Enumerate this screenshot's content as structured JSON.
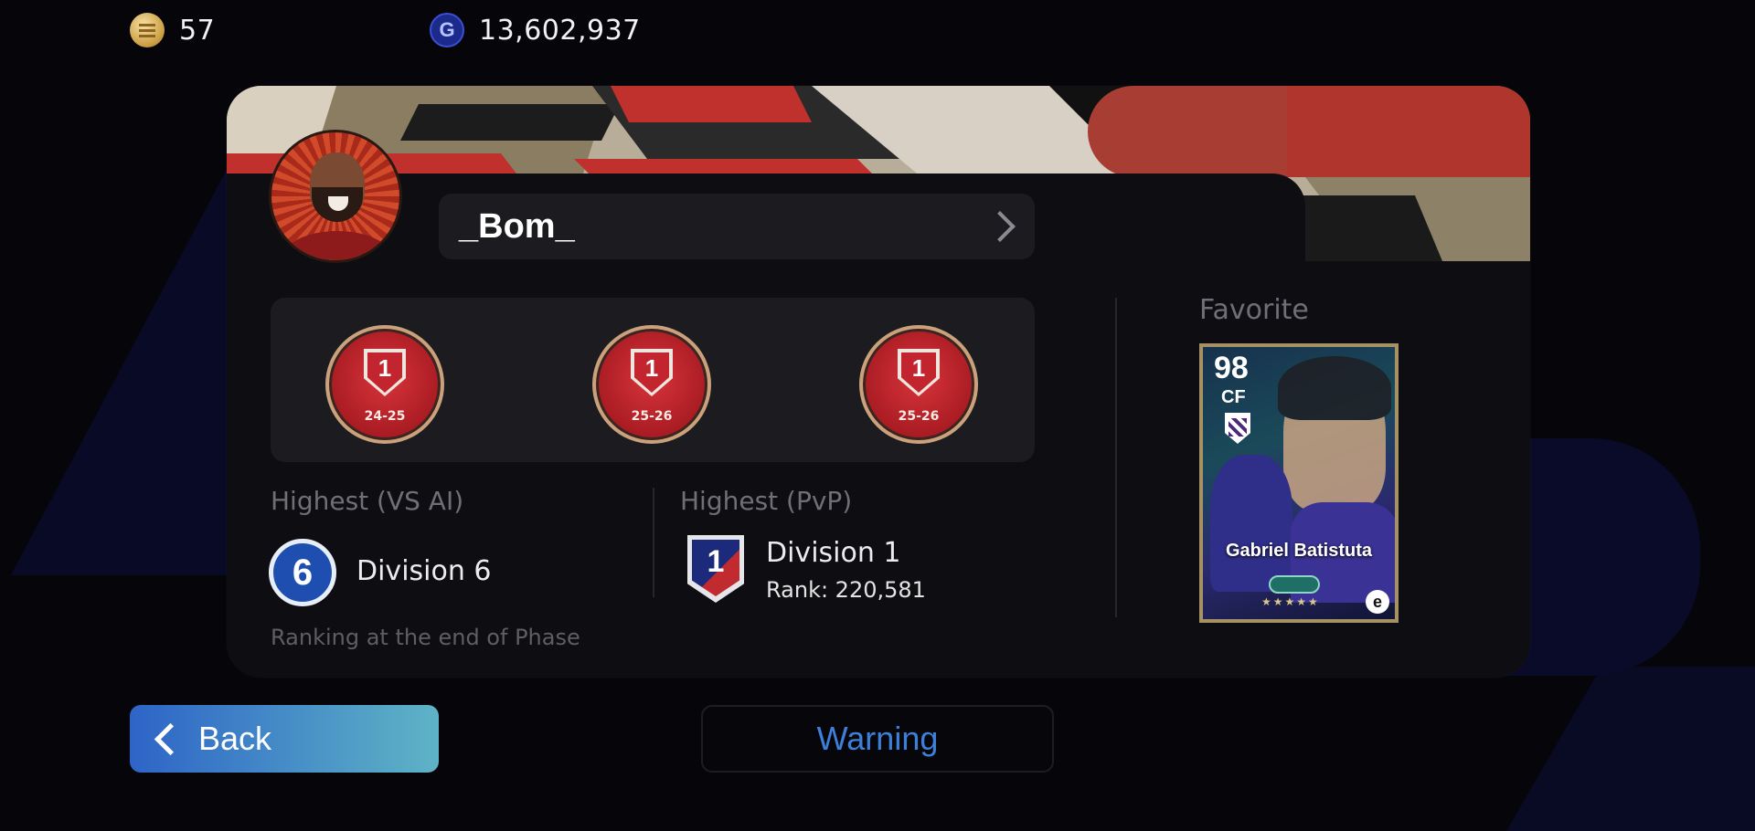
{
  "currency": {
    "coins": "57",
    "gp": "13,602,937",
    "gp_icon_letter": "G"
  },
  "profile": {
    "username": "_Bom_"
  },
  "badges": [
    {
      "rank": "1",
      "season": "24-25"
    },
    {
      "rank": "1",
      "season": "25-26"
    },
    {
      "rank": "1",
      "season": "25-26"
    }
  ],
  "highest_vs_ai": {
    "label": "Highest (VS AI)",
    "icon_number": "6",
    "division": "Division 6",
    "note": "Ranking at the end of Phase"
  },
  "highest_pvp": {
    "label": "Highest (PvP)",
    "icon_number": "1",
    "division": "Division 1",
    "rank": "Rank: 220,581"
  },
  "favorite": {
    "label": "Favorite",
    "rating": "98",
    "position": "CF",
    "player_name": "Gabriel Batistuta",
    "stars": "★★★★★",
    "logo_letter": "e"
  },
  "buttons": {
    "back": "Back",
    "warning": "Warning"
  },
  "colors": {
    "background": "#05050a",
    "card": "#0e0e12",
    "panel": "#1b1b20",
    "badge_red": "#a81b22",
    "back_button": "#2e64c7",
    "warning_text": "#3d7fd9"
  },
  "icons": [
    "coin-icon",
    "gp-icon",
    "chevron-right-icon",
    "badge-icon",
    "division-icon",
    "back-arrow-icon"
  ]
}
